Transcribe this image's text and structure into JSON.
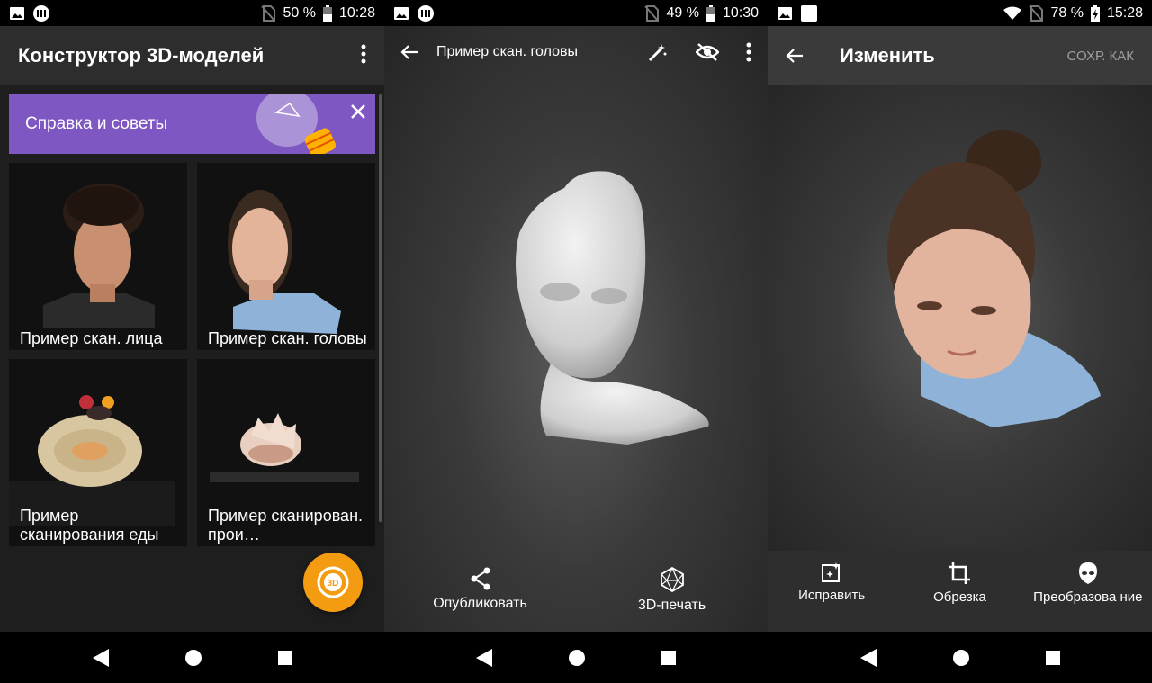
{
  "screen1": {
    "status": {
      "battery": "50 %",
      "time": "10:28"
    },
    "title": "Конструктор 3D-моделей",
    "help_banner": "Справка и советы",
    "cards": [
      {
        "label": "Пример скан. лица"
      },
      {
        "label": "Пример скан. головы"
      },
      {
        "label": "Пример сканирования еды"
      },
      {
        "label": "Пример сканирован. прои…"
      }
    ],
    "fab_label": "3D"
  },
  "screen2": {
    "status": {
      "battery": "49 %",
      "time": "10:30"
    },
    "title": "Пример скан. головы",
    "actions": [
      {
        "label": "Опубликовать",
        "icon": "share-icon"
      },
      {
        "label": "3D-печать",
        "icon": "polyhedron-icon"
      }
    ]
  },
  "screen3": {
    "status": {
      "battery": "78 %",
      "time": "15:28"
    },
    "title": "Изменить",
    "save_as": "СОХР. КАК",
    "tools": [
      {
        "label": "Исправить",
        "icon": "auto-fix-icon"
      },
      {
        "label": "Обрезка",
        "icon": "crop-icon"
      },
      {
        "label": "Преобразова ние",
        "icon": "alien-head-icon"
      }
    ]
  },
  "colors": {
    "banner": "#7e57c2",
    "fab": "#f39c12"
  }
}
